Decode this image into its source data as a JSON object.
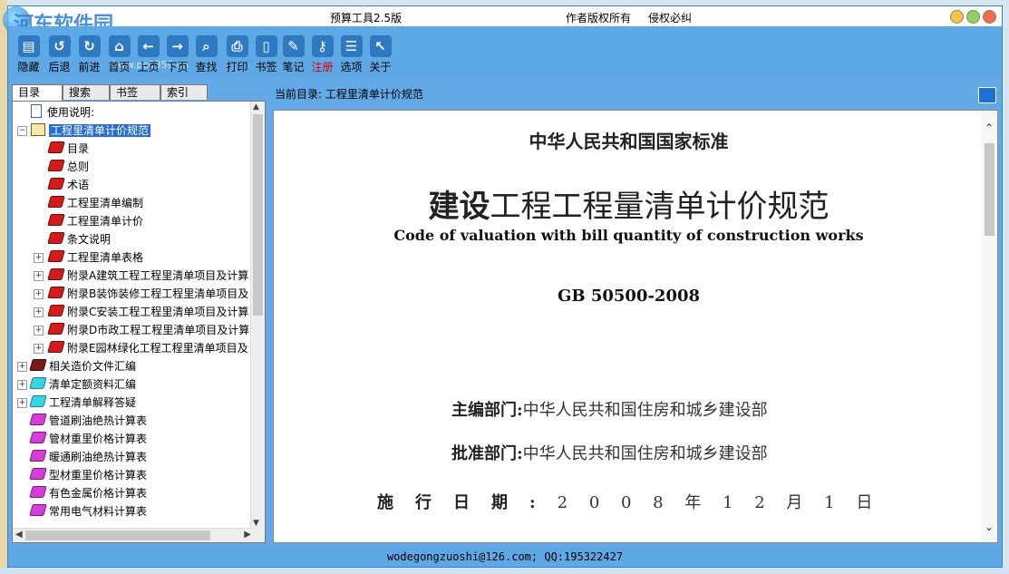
{
  "window": {
    "app_title": "预算工具2.5版",
    "copyright": "作者版权所有",
    "infringement": "侵权必纠",
    "watermark": "河东软件园",
    "watermark_url": "www.pc0359.cn"
  },
  "toolbar": [
    {
      "label": "隐藏",
      "icon": "hide-icon",
      "glyph": "▤"
    },
    {
      "label": "后退",
      "icon": "back-icon",
      "glyph": "↺"
    },
    {
      "label": "前进",
      "icon": "forward-icon",
      "glyph": "↻"
    },
    {
      "label": "首页",
      "icon": "home-icon",
      "glyph": "⌂"
    },
    {
      "label": "上页",
      "icon": "prev-page-icon",
      "glyph": "←"
    },
    {
      "label": "下页",
      "icon": "next-page-icon",
      "glyph": "→"
    },
    {
      "label": "查找",
      "icon": "search-icon",
      "glyph": "⌕"
    },
    {
      "label": "打印",
      "icon": "print-icon",
      "glyph": "⎙"
    },
    {
      "label": "书签",
      "icon": "bookmark-icon",
      "glyph": "▯"
    },
    {
      "label": "笔记",
      "icon": "note-icon",
      "glyph": "✎"
    },
    {
      "label": "注册",
      "icon": "register-icon",
      "glyph": "⚷",
      "highlight": true
    },
    {
      "label": "选项",
      "icon": "options-icon",
      "glyph": "☰"
    },
    {
      "label": "关于",
      "icon": "about-icon",
      "glyph": "↖"
    }
  ],
  "left_tabs": [
    "目录",
    "搜索",
    "书签",
    "索引"
  ],
  "tree": [
    {
      "label": "使用说明:",
      "icon": "doc",
      "level": 1
    },
    {
      "label": "工程里清单计价规范",
      "icon": "openbook",
      "level": 0,
      "expander": "⊟",
      "selected": true
    },
    {
      "label": "目录",
      "icon": "red",
      "level": 2
    },
    {
      "label": "总则",
      "icon": "red",
      "level": 2
    },
    {
      "label": "术语",
      "icon": "red",
      "level": 2
    },
    {
      "label": "工程里清单编制",
      "icon": "red",
      "level": 2
    },
    {
      "label": "工程里清单计价",
      "icon": "red",
      "level": 2
    },
    {
      "label": "条文说明",
      "icon": "red",
      "level": 2
    },
    {
      "label": "工程里清单表格",
      "icon": "red",
      "level": 2,
      "expander": "+"
    },
    {
      "label": "附录A建筑工程工程里清单项目及计算",
      "icon": "red",
      "level": 2,
      "expander": "+"
    },
    {
      "label": "附录B装饰装修工程工程里清单项目及",
      "icon": "red",
      "level": 2,
      "expander": "+"
    },
    {
      "label": "附录C安装工程工程里清单项目及计算",
      "icon": "red",
      "level": 2,
      "expander": "+"
    },
    {
      "label": "附录D市政工程工程里清单项目及计算",
      "icon": "red",
      "level": 2,
      "expander": "+"
    },
    {
      "label": "附录E园林绿化工程工程里清单项目及",
      "icon": "red",
      "level": 2,
      "expander": "+"
    },
    {
      "label": "相关造价文件汇编",
      "icon": "dark",
      "level": 0,
      "expander": "+"
    },
    {
      "label": "清单定额资料汇编",
      "icon": "cyan",
      "level": 0,
      "expander": "+"
    },
    {
      "label": "工程清单解释答疑",
      "icon": "cyan",
      "level": 0,
      "expander": "+"
    },
    {
      "label": "管道刷油绝热计算表",
      "icon": "magenta",
      "level": 1
    },
    {
      "label": "管材重里价格计算表",
      "icon": "magenta",
      "level": 1
    },
    {
      "label": "暖通刷油绝热计算表",
      "icon": "magenta",
      "level": 1
    },
    {
      "label": "型材重里价格计算表",
      "icon": "magenta",
      "level": 1
    },
    {
      "label": "有色金属价格计算表",
      "icon": "magenta",
      "level": 1
    },
    {
      "label": "常用电气材料计算表",
      "icon": "magenta",
      "level": 1
    }
  ],
  "path": {
    "label": "当前目录:",
    "value": "工程里清单计价规范"
  },
  "document": {
    "heading": "中华人民共和国国家标准",
    "title_bold": "建设",
    "title_rest": "工程工程量清单计价规范",
    "title_en": "Code of valuation with bill quantity of construction works",
    "code": "GB 50500-2008",
    "editor_label": "主编部门:",
    "editor_value": "中华人民共和国住房和城乡建设部",
    "approver_label": "批准部门:",
    "approver_value": "中华人民共和国住房和城乡建设部",
    "date_label": "施行日期:",
    "date_value": "2 0 0 8 年 1 2 月 1 日"
  },
  "status": "wodegongzuoshi@126.com; QQ:195322427",
  "colors": {
    "frame": "#5ea8e6",
    "selected": "#2a6dd1",
    "register": "#d40000"
  }
}
